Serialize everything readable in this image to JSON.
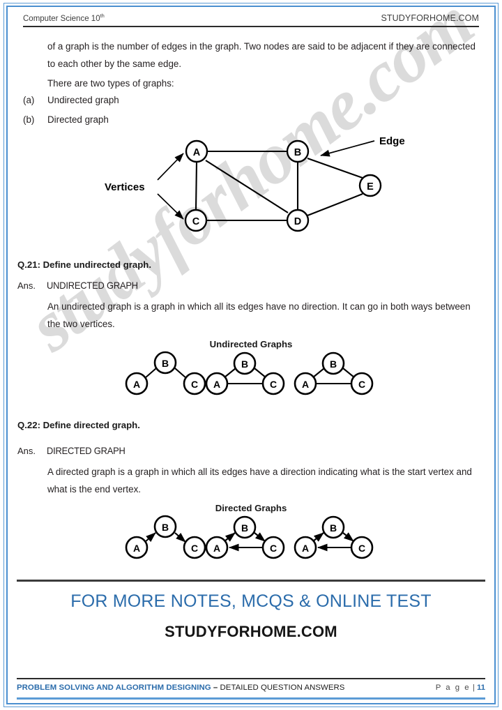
{
  "header": {
    "subject": "Computer Science 10",
    "subject_sup": "th",
    "site": "STUDYFORHOME.COM"
  },
  "body": {
    "para1": "of a graph is the number of edges in the graph. Two nodes are said to be adjacent if they are connected to each other by the same edge.",
    "para2": "There are two types of graphs:",
    "item_a_marker": "(a)",
    "item_a_text": "Undirected graph",
    "item_b_marker": "(b)",
    "item_b_text": "Directed graph"
  },
  "main_graph": {
    "label_vertices": "Vertices",
    "label_edge": "Edge",
    "nodes": [
      "A",
      "B",
      "C",
      "D",
      "E"
    ],
    "edges": [
      "A-B",
      "A-C",
      "A-D",
      "B-D",
      "B-E",
      "C-D",
      "D-E"
    ]
  },
  "q21": {
    "question": "Q.21: Define undirected graph.",
    "ans_label": "Ans.",
    "ans_heading": "UNDIRECTED GRAPH",
    "ans_text": "An undirected graph is a graph in which all its edges have no direction. It can go in both ways between the two vertices.",
    "diagram_caption": "Undirected Graphs",
    "graphs": [
      {
        "nodes": [
          "A",
          "B",
          "C"
        ],
        "edges": [
          "A-B",
          "B-C"
        ]
      },
      {
        "nodes": [
          "A",
          "B",
          "C"
        ],
        "edges": [
          "A-B",
          "B-C",
          "A-C"
        ]
      },
      {
        "nodes": [
          "A",
          "B",
          "C"
        ],
        "edges": [
          "A-B",
          "B-C",
          "A-C"
        ]
      }
    ]
  },
  "q22": {
    "question": "Q.22: Define directed graph.",
    "ans_label": "Ans.",
    "ans_heading": "DIRECTED GRAPH",
    "ans_text": "A directed graph is a graph in which all its edges have a direction indicating what is the start vertex and what is the end vertex.",
    "diagram_caption": "Directed Graphs",
    "graphs": [
      {
        "nodes": [
          "A",
          "B",
          "C"
        ],
        "edges": [
          "A->B",
          "B->C"
        ]
      },
      {
        "nodes": [
          "A",
          "B",
          "C"
        ],
        "edges": [
          "A->B",
          "B->C",
          "C->A"
        ]
      },
      {
        "nodes": [
          "A",
          "B",
          "C"
        ],
        "edges": [
          "A->B",
          "B->C",
          "C->A"
        ]
      }
    ]
  },
  "promo": {
    "line1": "FOR MORE NOTES, MCQS & ONLINE TEST",
    "line2": "STUDYFORHOME.COM"
  },
  "footer": {
    "chapter": "PROBLEM SOLVING AND ALGORITHM DESIGNING",
    "dash": "–",
    "section": "DETAILED QUESTION ANSWERS",
    "page_word": "P a g e",
    "page_sep": "|",
    "page_number": "11"
  },
  "watermark": {
    "text": "studyforhome.com"
  },
  "colors": {
    "accent_blue": "#2b6cab",
    "border_blue": "#5b9bd5",
    "text_black": "#231f20",
    "watermark_gray": "#d9d9d9"
  }
}
